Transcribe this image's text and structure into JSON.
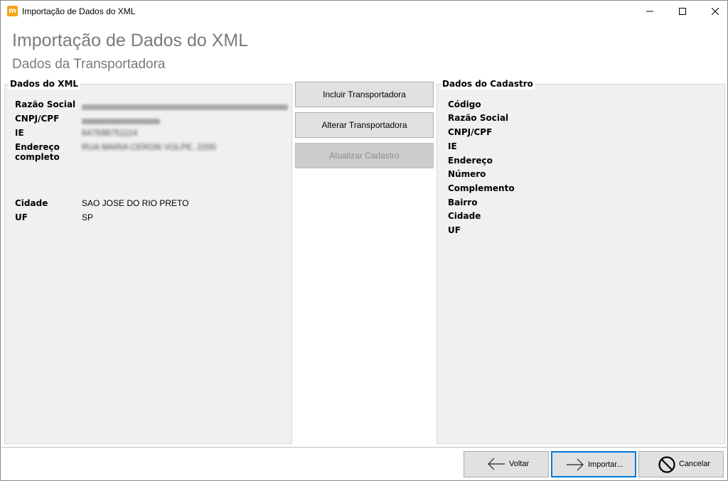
{
  "window": {
    "icon_letter": "m",
    "title": "Importação de Dados do XML"
  },
  "header": {
    "title": "Importação de Dados do XML",
    "subtitle": "Dados da Transportadora"
  },
  "xml_group": {
    "legend": "Dados do XML",
    "fields": {
      "razao_social_label": "Razão Social",
      "cnpj_label": "CNPJ/CPF",
      "ie_label": "IE",
      "ie_value": "647598751114",
      "endereco_label_1": "Endereço",
      "endereco_label_2": "completo",
      "endereco_value": "RUA MARIA CERON VOLPE, 2200",
      "cidade_label": "Cidade",
      "cidade_value": "SAO JOSE DO RIO PRETO",
      "uf_label": "UF",
      "uf_value": "SP"
    }
  },
  "actions": {
    "incluir": "Incluir Transportadora",
    "alterar": "Alterar Transportadora",
    "atualizar": "Atualizar Cadastro"
  },
  "cadastro_group": {
    "legend": "Dados do Cadastro",
    "labels": [
      "Código",
      "Razão Social",
      "CNPJ/CPF",
      "IE",
      "Endereço",
      "Número",
      "Complemento",
      "Bairro",
      "Cidade",
      "UF"
    ]
  },
  "footer": {
    "voltar": "Voltar",
    "importar": "Importar...",
    "cancelar": "Cancelar"
  }
}
